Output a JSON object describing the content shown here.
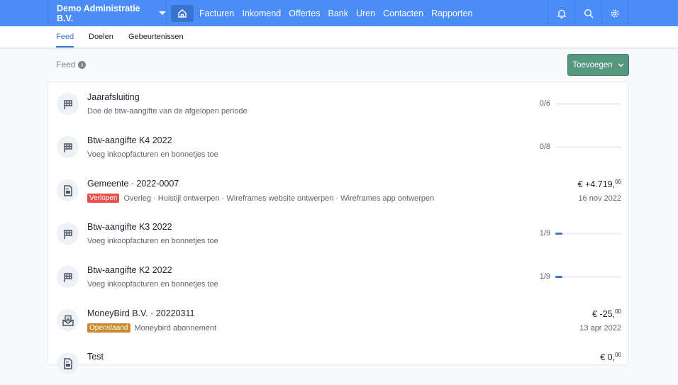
{
  "topbar": {
    "org": "Demo Administratie B.V.",
    "nav": [
      "Facturen",
      "Inkomend",
      "Offertes",
      "Bank",
      "Uren",
      "Contacten",
      "Rapporten"
    ]
  },
  "tabs": [
    "Feed",
    "Doelen",
    "Gebeurtenissen"
  ],
  "feed": {
    "label": "Feed",
    "add_label": "Toevoegen"
  },
  "colors": {
    "primary": "#4a8df6",
    "add": "#56977f",
    "expired": "#e5534b",
    "open": "#c98a2b"
  },
  "items": [
    {
      "icon": "flag",
      "title": "Jaarafsluiting",
      "desc": "Doe de btw-aangifte van de afgelopen periode",
      "progress": "0/6",
      "fraction": 0
    },
    {
      "icon": "flag",
      "title": "Btw-aangifte K4 2022",
      "desc": "Voeg inkoopfacturen en bonnetjes toe",
      "progress": "0/8",
      "fraction": 0
    },
    {
      "icon": "document",
      "title": "Gemeente · 2022-0007",
      "badge": "Verlopen",
      "desc": "Overleg · Huistijl ontwerpen · Wireframes website ontwerpen · Wireframes app ontwerpen",
      "amount": "€ +4.719,",
      "cents": "00",
      "date": "16 nov 2022"
    },
    {
      "icon": "flag",
      "title": "Btw-aangifte K3 2022",
      "desc": "Voeg inkoopfacturen en bonnetjes toe",
      "progress": "1/9",
      "fraction": 0.111
    },
    {
      "icon": "flag",
      "title": "Btw-aangifte K2 2022",
      "desc": "Voeg inkoopfacturen en bonnetjes toe",
      "progress": "1/9",
      "fraction": 0.111
    },
    {
      "icon": "envelope",
      "title": "MoneyBird B.V. · 20220311",
      "badge": "Openstaand",
      "desc": "Moneybird abonnement",
      "amount": "€ -25,",
      "cents": "00",
      "date": "13 apr 2022"
    },
    {
      "icon": "document",
      "title": "Test",
      "amount": "€ 0,",
      "cents": "00"
    }
  ]
}
